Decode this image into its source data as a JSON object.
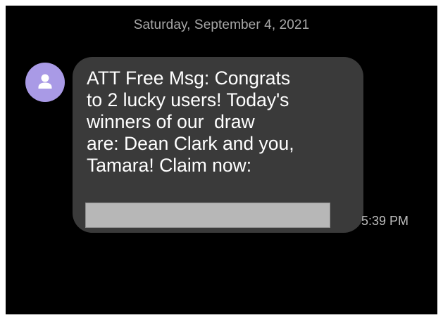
{
  "conversation": {
    "date_header": "Saturday, September 4, 2021"
  },
  "message": {
    "sender_icon": "person-icon",
    "lines": [
      "ATT Free Msg: Congrats",
      "to 2 lucky users! Today's",
      "winners of our  draw",
      "are: Dean Clark and you,",
      "Tamara! Claim now:"
    ],
    "timestamp": "5:39 PM"
  },
  "colors": {
    "background": "#000000",
    "bubble": "#3a3a3a",
    "avatar": "#a99ae6",
    "redaction": "#b7b7b7"
  }
}
